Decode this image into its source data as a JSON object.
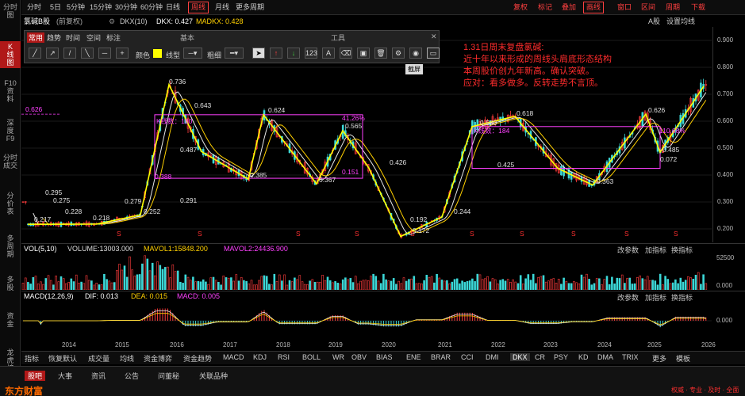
{
  "sidebar": {
    "items": [
      {
        "label": "分时\n图",
        "active": false
      },
      {
        "label": "K\n线\n图",
        "active": true
      },
      {
        "label": "F10\n资\n料",
        "active": false
      },
      {
        "label": "深\n度\nF9",
        "active": false
      },
      {
        "label": "分时\n成交",
        "active": false
      },
      {
        "label": "分\n价\n表",
        "active": false
      },
      {
        "label": "多\n周\n期",
        "active": false
      },
      {
        "label": "多\n股",
        "active": false
      },
      {
        "label": "资\n金",
        "active": false
      },
      {
        "label": "龙\n虎\n榜",
        "active": false
      }
    ]
  },
  "topbar": {
    "left": [
      "分时",
      "5日",
      "5分钟",
      "15分钟",
      "30分钟",
      "60分钟",
      "日线",
      "周线",
      "月线",
      "更多周期"
    ],
    "active": "周线",
    "right": [
      "复权",
      "标记",
      "叠加",
      "画线",
      "窗口",
      "区间",
      "周期",
      "下载"
    ]
  },
  "info": {
    "stock_name": "氯碱B股",
    "adj_note": "(前复权)",
    "indicator": "DKX(10)",
    "dkx": "DKX: 0.427",
    "madkx": "MADKX: 0.428",
    "right_labels": [
      "A股",
      "设置均线"
    ]
  },
  "drawbar": {
    "tabs": [
      "常用",
      "趋势",
      "时间",
      "空间",
      "标注"
    ],
    "sections": [
      "基本",
      "工具"
    ],
    "color_label": "颜色",
    "line_label": "线型",
    "width_label": "粗细",
    "screenshot_tip": "截屏"
  },
  "annotation": {
    "lines": [
      "1.31日周末复盘氯碱:",
      "近十年以来形成的周线头肩底形态结构",
      "本周股价创九年新高。确认突破。",
      "应对：看多做多。反转走势不言顶。"
    ]
  },
  "colors": {
    "up": "#ff3c3c",
    "down": "#3cd8d8",
    "zigzag": "#ffff00",
    "box": "#ff40ff",
    "ma1": "#e8e8e8",
    "ma2": "#ffd000",
    "ma3": "#ff40ff",
    "bg": "#000000",
    "accent": "#b01818"
  },
  "price_axis": {
    "labels": [
      "0.900",
      "0.800",
      "0.700",
      "0.600",
      "0.500",
      "0.400",
      "0.300",
      "0.200"
    ]
  },
  "time_axis": {
    "labels": [
      "2014",
      "2015",
      "2016",
      "2017",
      "2018",
      "2019",
      "2020",
      "2021",
      "2022",
      "2023",
      "2024",
      "2025",
      "2026"
    ]
  },
  "chart_labels": {
    "peaks": [
      "0.295",
      "0.275",
      "0.228",
      "0.217",
      "0.218",
      "0.279",
      "0.252",
      "0.736",
      "0.643",
      "0.487",
      "0.291",
      "0.624",
      "0.565",
      "0.385",
      "0.367",
      "0.426",
      "0.192",
      "0.172",
      "0.244",
      "0.580",
      "0.618",
      "0.425",
      "0.363",
      "0.626",
      "0.485",
      "0.072",
      "0.626"
    ],
    "box1_pct": "41.26%",
    "box1_lbl": "K线数：180",
    "box1_low": "0.388",
    "box1_pct2": "0.151",
    "box2_lbl": "K线数：184",
    "box2_pct": "110.68%"
  },
  "chart_data": {
    "type": "line",
    "title": "氯碱B股 周线",
    "x": [
      "2014",
      "2015",
      "2016",
      "2017",
      "2018",
      "2019",
      "2020",
      "2021",
      "2022",
      "2023",
      "2024",
      "2025",
      "2026"
    ],
    "zigzag_series": {
      "name": "zigzag",
      "points": [
        [
          "2014",
          0.217
        ],
        [
          "2015",
          0.218
        ],
        [
          "2015",
          0.252
        ],
        [
          "2016",
          0.736
        ],
        [
          "2016",
          0.487
        ],
        [
          "2017",
          0.385
        ],
        [
          "2017",
          0.624
        ],
        [
          "2018",
          0.367
        ],
        [
          "2019",
          0.565
        ],
        [
          "2019",
          0.426
        ],
        [
          "2020",
          0.172
        ],
        [
          "2021",
          0.244
        ],
        [
          "2021",
          0.58
        ],
        [
          "2022",
          0.618
        ],
        [
          "2022",
          0.425
        ],
        [
          "2023",
          0.363
        ],
        [
          "2024",
          0.626
        ],
        [
          "2025",
          0.485
        ],
        [
          "2025",
          0.73
        ]
      ]
    },
    "ylim": [
      0.15,
      0.95
    ]
  },
  "volume": {
    "label": "VOL(5,10)",
    "volume": "VOLUME:13003.000",
    "mavol1": "MAVOL1:15848.200",
    "mavol2": "MAVOL2:24436.900",
    "axis": [
      "52500",
      "0.000"
    ],
    "tools": [
      "改参数",
      "加指标",
      "换指标"
    ]
  },
  "macd": {
    "label": "MACD(12,26,9)",
    "dif": "DIF: 0.013",
    "dea": "DEA: 0.015",
    "macd": "MACD: 0.005",
    "axis": [
      "0.000"
    ],
    "tools": [
      "改参数",
      "加指标",
      "换指标"
    ]
  },
  "bottomtabs": [
    "指标",
    "恢复默认",
    "成交量",
    "均线",
    "资金博弈",
    "资金趋势",
    "MACD",
    "KDJ",
    "RSI",
    "BOLL",
    "WR",
    "OBV",
    "BIAS",
    "ENE",
    "BRAR",
    "CCI",
    "DMI",
    "DKX",
    "CR",
    "PSY",
    "KD",
    "DMA",
    "TRIX",
    "更多",
    "模板"
  ],
  "footer": {
    "tabs": [
      "股吧",
      "大事",
      "资讯",
      "公告",
      "问董秘",
      "关联品种"
    ],
    "brand": "东方财富",
    "slogan": "权威 · 专业 · 及时 · 全面"
  }
}
